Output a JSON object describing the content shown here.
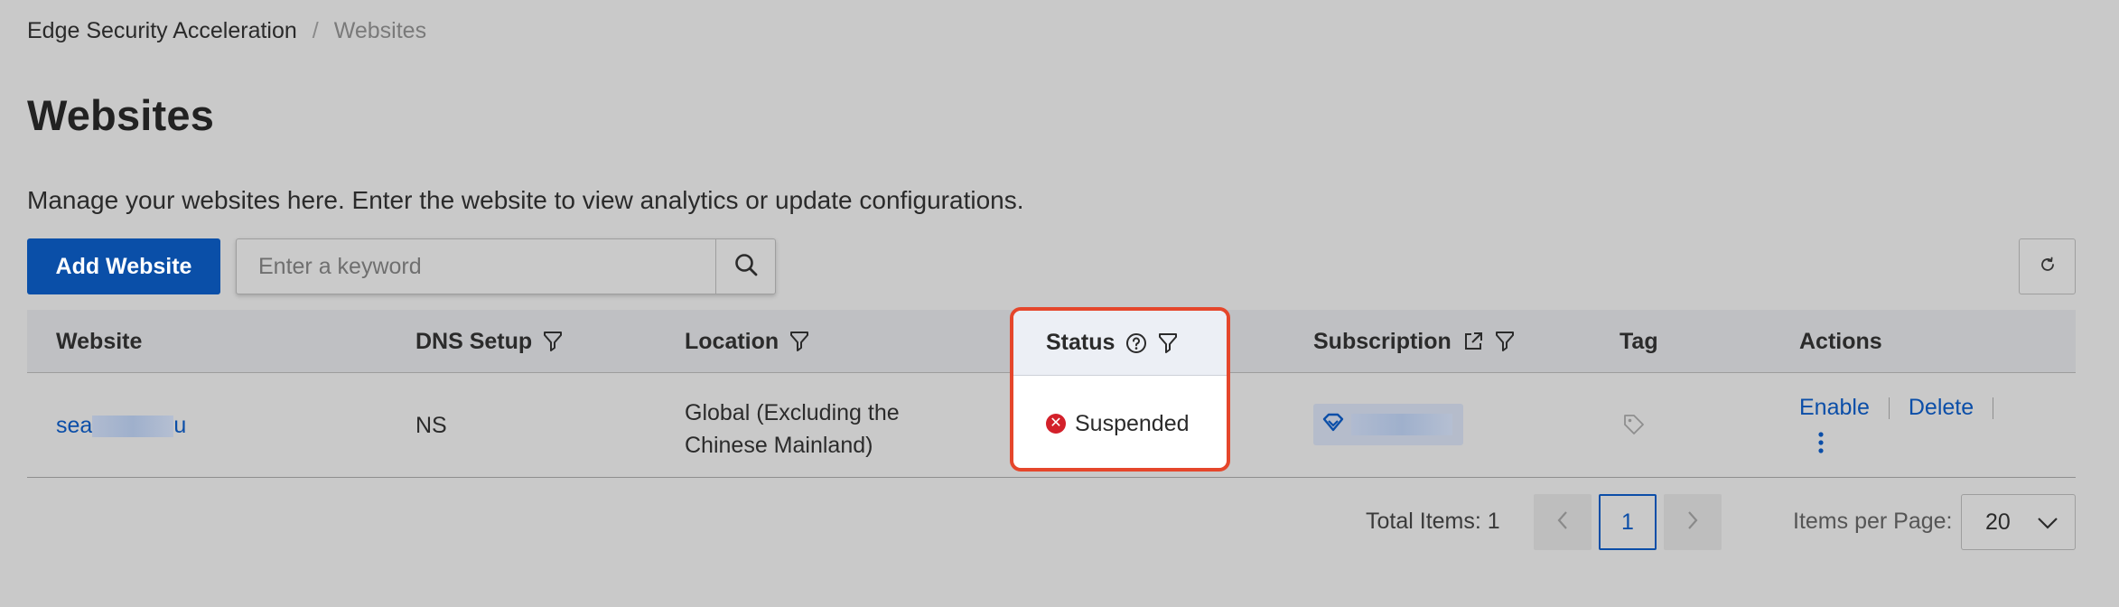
{
  "breadcrumb": {
    "root": "Edge Security Acceleration",
    "separator": "/",
    "current": "Websites"
  },
  "page": {
    "title": "Websites",
    "description": "Manage your websites here. Enter the website to view analytics or update configurations."
  },
  "toolbar": {
    "add_label": "Add Website",
    "search_placeholder": "Enter a keyword",
    "search_icon": "search-icon",
    "refresh_icon": "refresh-icon"
  },
  "table": {
    "columns": {
      "website": "Website",
      "dns": "DNS Setup",
      "location": "Location",
      "status": "Status",
      "subscription": "Subscription",
      "tag": "Tag",
      "actions": "Actions"
    },
    "rows": [
      {
        "website_prefix": "sea",
        "website_suffix": "u",
        "dns": "NS",
        "location_line1": "Global (Excluding the",
        "location_line2": "Chinese Mainland)",
        "status": "Suspended",
        "status_color": "#d3202a",
        "actions": {
          "enable": "Enable",
          "delete": "Delete"
        }
      }
    ]
  },
  "pagination": {
    "total_label": "Total Items: 1",
    "current_page": "1",
    "items_per_page_label": "Items per Page:",
    "items_per_page": "20"
  },
  "colors": {
    "accent": "#0a4fa8",
    "highlight": "#e5462b",
    "background": "#c9c9c9"
  }
}
